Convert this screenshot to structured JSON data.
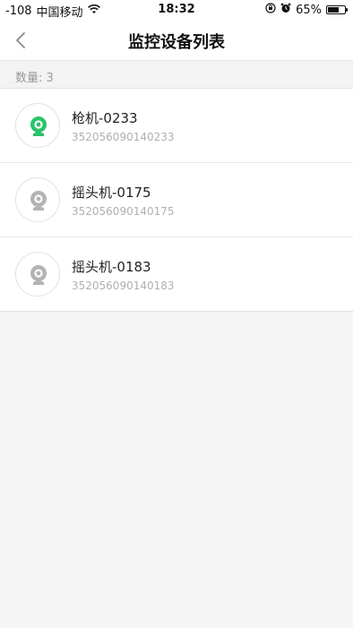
{
  "status_bar": {
    "signal": "-108",
    "carrier": "中国移动",
    "time": "18:32",
    "battery_text": "65%",
    "battery_level": 0.65
  },
  "nav": {
    "title": "监控设备列表",
    "back_icon": "chevron-left-icon"
  },
  "count": {
    "label": "数量:",
    "value": "3"
  },
  "devices": [
    {
      "name": "枪机-0233",
      "serial": "352056090140233",
      "icon": "camera-icon",
      "status_color": "#2ac36a"
    },
    {
      "name": "摇头机-0175",
      "serial": "352056090140175",
      "icon": "camera-icon",
      "status_color": "#b3b3b3"
    },
    {
      "name": "摇头机-0183",
      "serial": "352056090140183",
      "icon": "camera-icon",
      "status_color": "#b3b3b3"
    }
  ]
}
